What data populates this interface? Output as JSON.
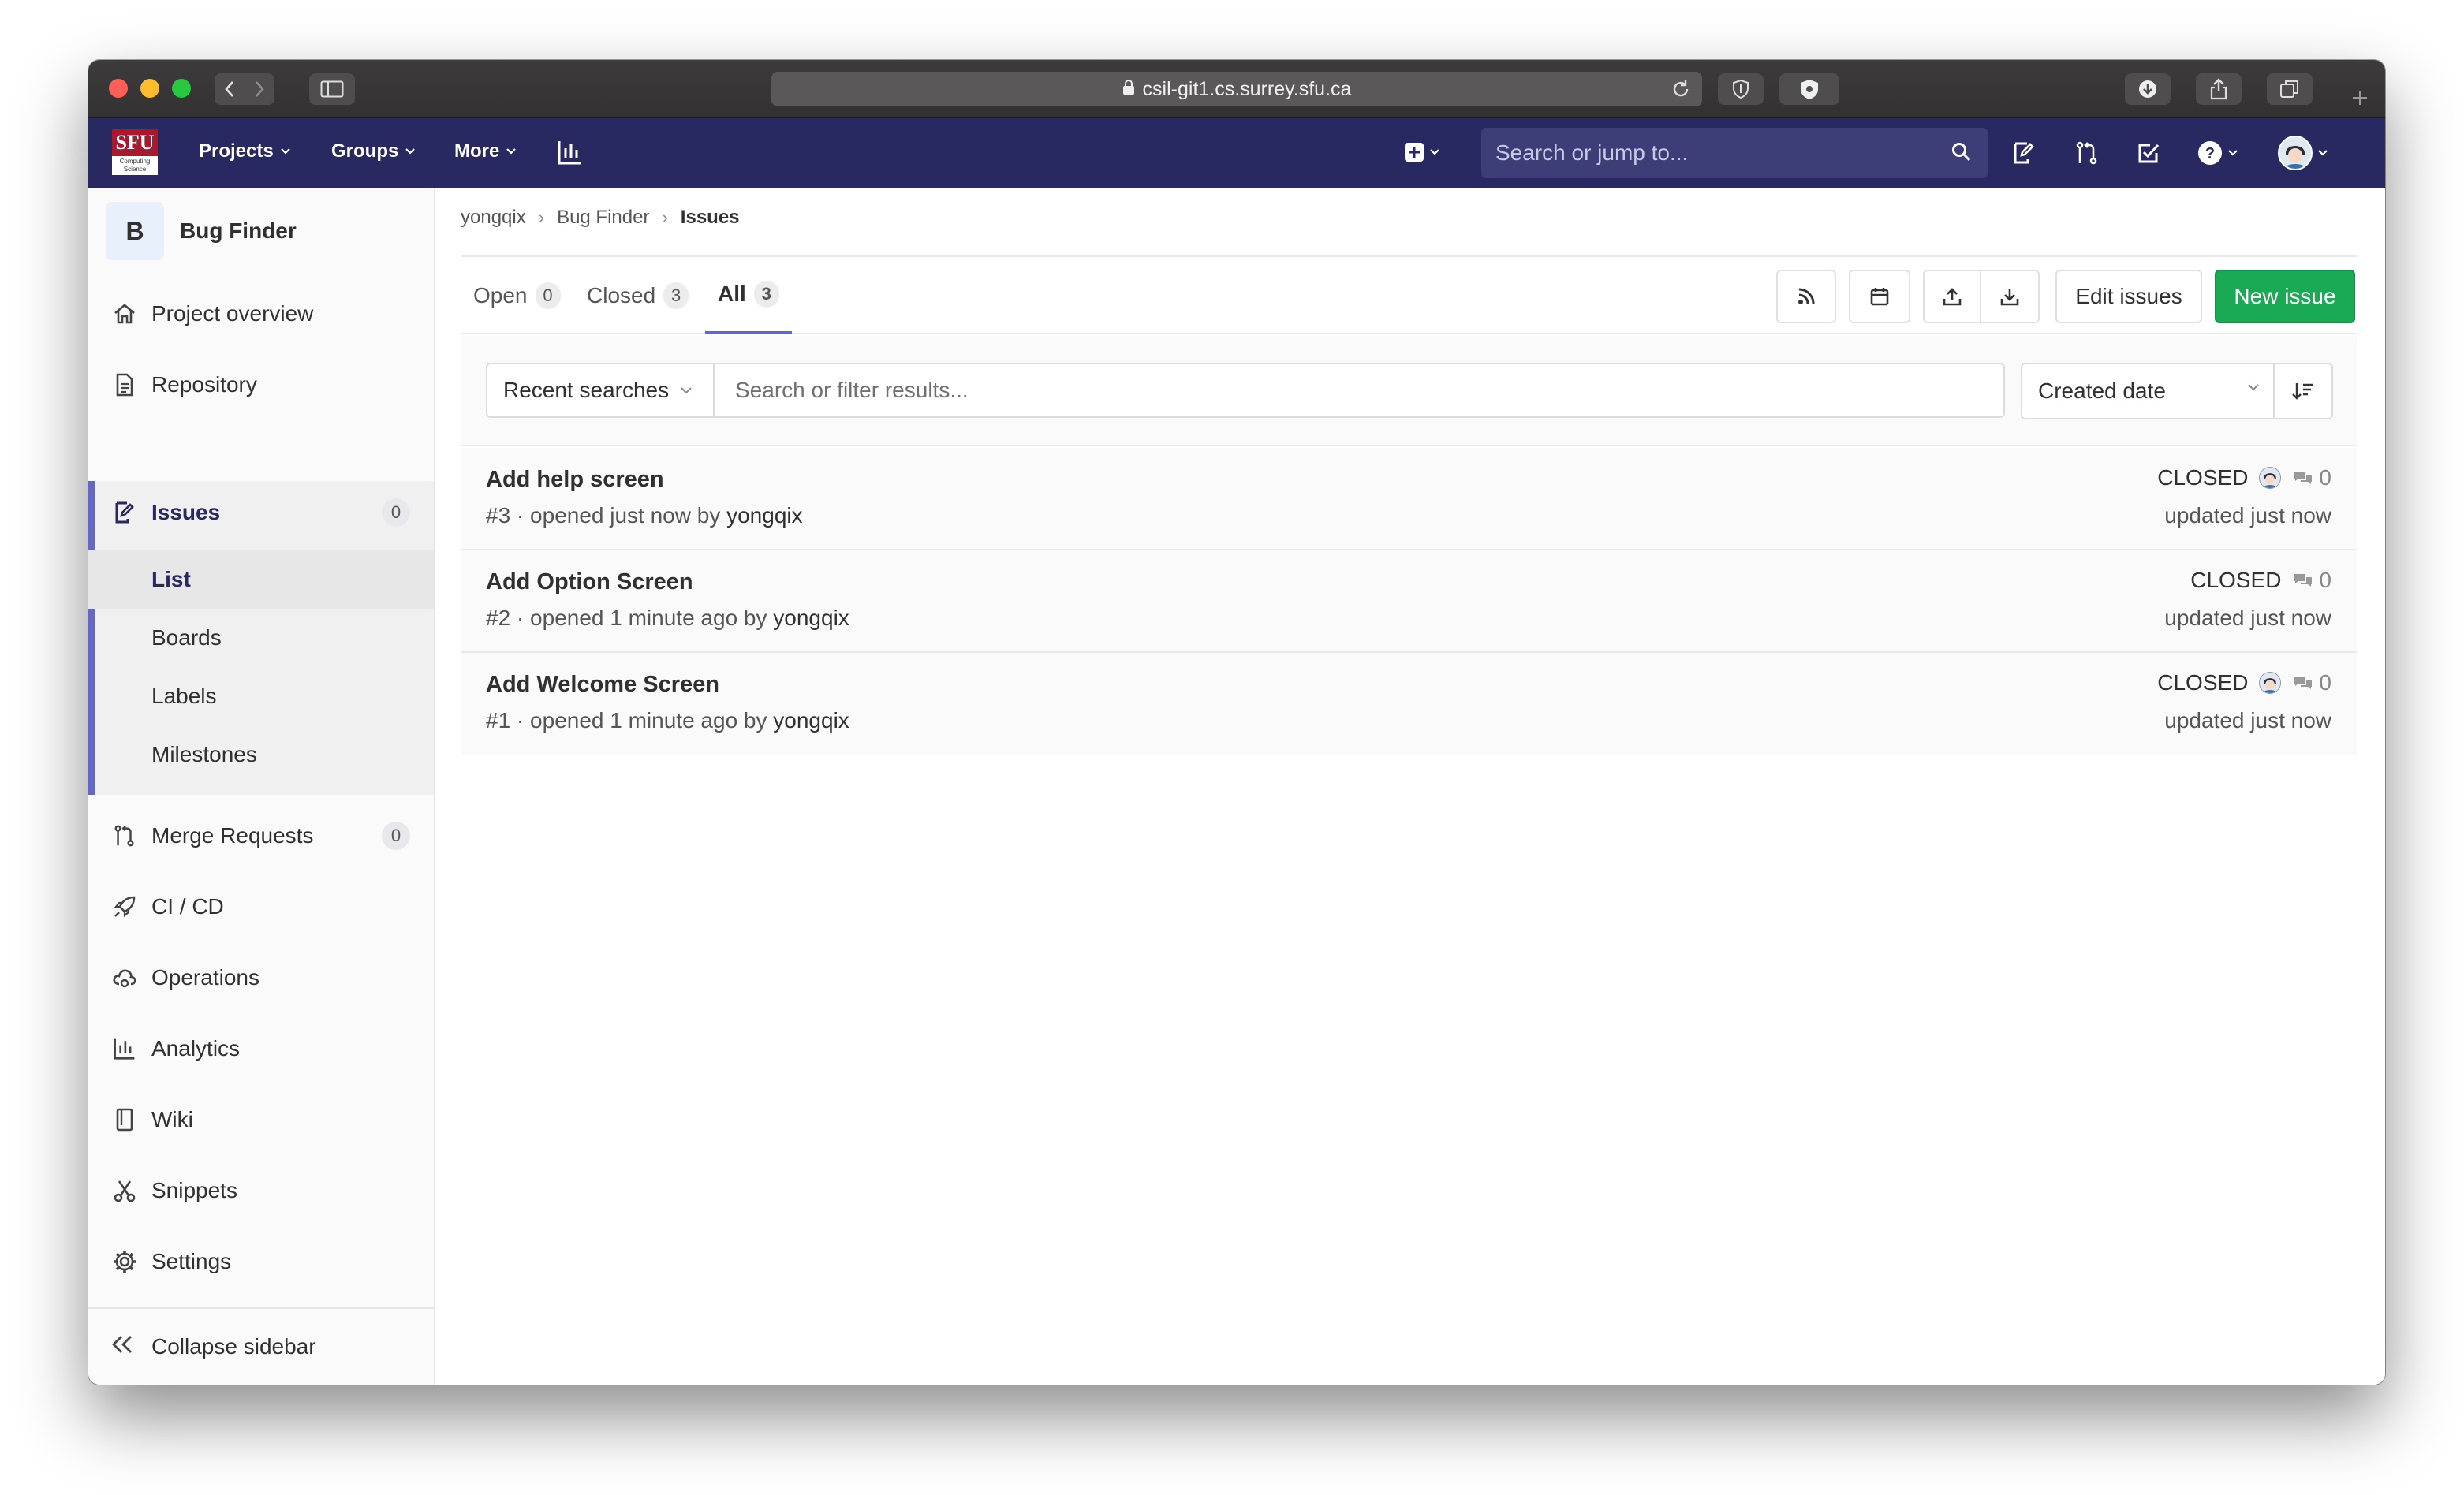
{
  "browser": {
    "url": "csil-git1.cs.surrey.sfu.ca"
  },
  "header": {
    "logo_text": "SFU",
    "logo_sub": "Computing Science",
    "nav": [
      "Projects",
      "Groups",
      "More"
    ],
    "search_placeholder": "Search or jump to..."
  },
  "sidebar": {
    "project_initial": "B",
    "project_name": "Bug Finder",
    "items": [
      {
        "label": "Project overview",
        "icon": "home-icon"
      },
      {
        "label": "Repository",
        "icon": "doc-icon"
      },
      {
        "label": "Issues",
        "icon": "issues-icon",
        "count": "0"
      },
      {
        "label": "Merge Requests",
        "icon": "merge-request-icon",
        "count": "0"
      },
      {
        "label": "CI / CD",
        "icon": "rocket-icon"
      },
      {
        "label": "Operations",
        "icon": "cloud-icon"
      },
      {
        "label": "Analytics",
        "icon": "chart-icon"
      },
      {
        "label": "Wiki",
        "icon": "book-icon"
      },
      {
        "label": "Snippets",
        "icon": "scissors-icon"
      },
      {
        "label": "Settings",
        "icon": "gear-icon"
      }
    ],
    "issues_sub": [
      "List",
      "Boards",
      "Labels",
      "Milestones"
    ],
    "collapse_label": "Collapse sidebar"
  },
  "breadcrumb": {
    "items": [
      "yongqix",
      "Bug Finder",
      "Issues"
    ]
  },
  "tabs": [
    {
      "label": "Open",
      "count": "0"
    },
    {
      "label": "Closed",
      "count": "3"
    },
    {
      "label": "All",
      "count": "3"
    }
  ],
  "toolbar": {
    "edit_label": "Edit issues",
    "new_label": "New issue"
  },
  "filter": {
    "recent_label": "Recent searches",
    "placeholder": "Search or filter results...",
    "sort_label": "Created date"
  },
  "issues": [
    {
      "title": "Add help screen",
      "number": "#3",
      "opened": "opened just now by",
      "author": "yongqix",
      "status": "CLOSED",
      "comments": "0",
      "updated": "updated just now",
      "assignee": true
    },
    {
      "title": "Add Option Screen",
      "number": "#2",
      "opened": "opened 1 minute ago by",
      "author": "yongqix",
      "status": "CLOSED",
      "comments": "0",
      "updated": "updated just now",
      "assignee": false
    },
    {
      "title": "Add Welcome Screen",
      "number": "#1",
      "opened": "opened 1 minute ago by",
      "author": "yongqix",
      "status": "CLOSED",
      "comments": "0",
      "updated": "updated just now",
      "assignee": true
    }
  ],
  "colors": {
    "header": "#292961",
    "accent": "#6666c4",
    "new_issue": "#1aaa55"
  }
}
